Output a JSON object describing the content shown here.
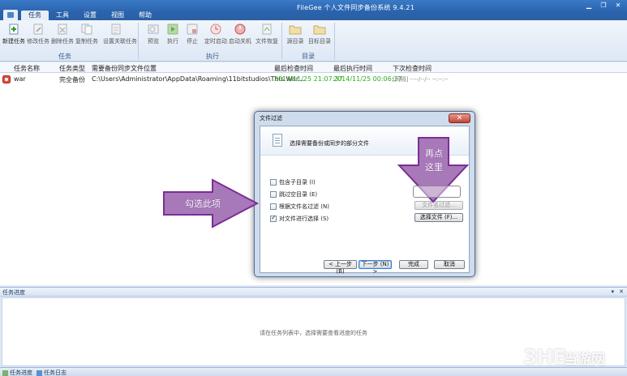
{
  "window": {
    "title": "FileGee 个人文件同步备份系统 9.4.21",
    "controls": [
      "▁",
      "❐",
      "✕"
    ]
  },
  "menu_tabs": [
    "任务",
    "工具",
    "设置",
    "视图",
    "帮助"
  ],
  "ribbon": {
    "groups": [
      {
        "label": "任务",
        "buttons": [
          "新建任务",
          "修改任务",
          "删除任务",
          "复制任务",
          "设置关联任务"
        ]
      },
      {
        "label": "执行",
        "buttons": [
          "预览",
          "执行",
          "停止",
          "定时启动",
          "启动关机",
          "文件恢复"
        ]
      },
      {
        "label": "目录",
        "buttons": [
          "源目录",
          "目标目录"
        ]
      }
    ]
  },
  "task_list": {
    "columns": [
      "任务名称",
      "任务类型",
      "需要备份同步文件位置",
      "最后检查时间",
      "最后执行时间",
      "下次检查时间"
    ],
    "rows": [
      {
        "name": "war",
        "type": "完全备份",
        "path": "C:\\Users\\Administrator\\AppData\\Roaming\\11bitstudios\\This War...",
        "last_check": "2014/11/25 21:07:37",
        "last_exec": "2014/11/25 00:06:37",
        "next_check": "[间隔] ----/--/-- --:--:--"
      }
    ]
  },
  "progress_panel": {
    "title": "任务进度",
    "pin": "▾",
    "close": "✕",
    "message": "请在任务列表中，选择需要查看进度的任务"
  },
  "statusbar": {
    "tabs": [
      "任务进度",
      "任务日志"
    ]
  },
  "watermark": {
    "mark": "3HE",
    "text": "当游网"
  },
  "dialog": {
    "title": "文件过滤",
    "close": "✕",
    "heading": "选择需要备份或同步的部分文件",
    "options": [
      {
        "label": "包含子目录 (I)",
        "checked": false
      },
      {
        "label": "跳过空目录 (E)",
        "checked": false
      },
      {
        "label": "根据文件名过滤 (N)",
        "checked": false
      },
      {
        "label": "对文件进行选择 (S)",
        "checked": true
      }
    ],
    "filter_button": "文件名过滤...",
    "select_button": "选择文件 (F)...",
    "prev_button": "< 上一步 (B)",
    "next_button": "下一步 (N) >",
    "finish_button": "完成",
    "cancel_button": "取消"
  },
  "annotations": {
    "left_arrow_text": "勾选此项",
    "down_arrow_line1": "再点",
    "down_arrow_line2": "这里"
  },
  "colors": {
    "titlebar": "#2a63ad",
    "ribbon": "#dde8f5",
    "green_time": "#2eaa1e",
    "arrow_fill": "#a779b9",
    "arrow_stroke": "#7d2d96"
  }
}
